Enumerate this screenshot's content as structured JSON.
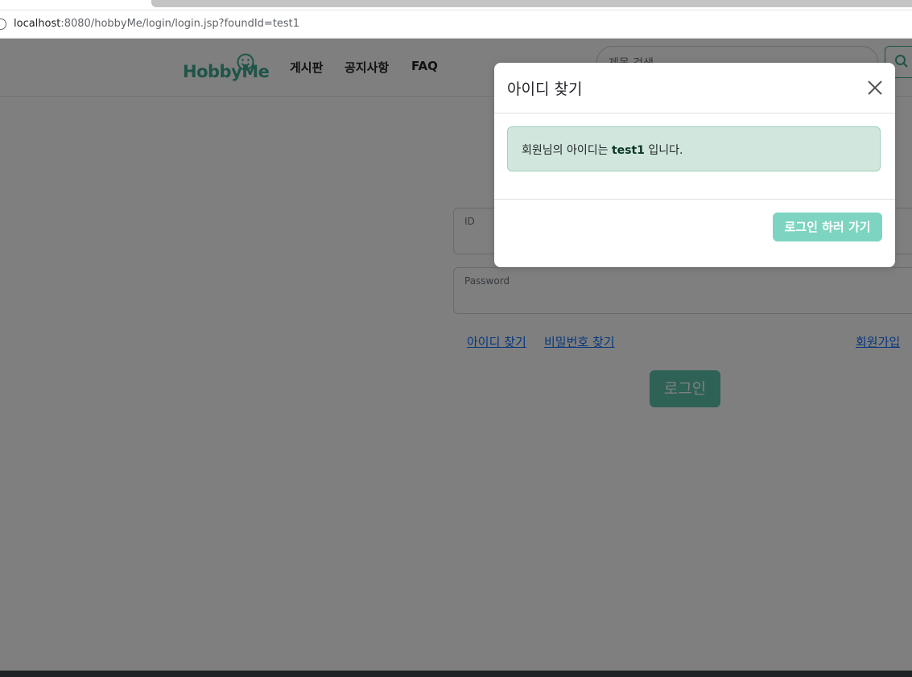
{
  "browser": {
    "url_host": "localhost",
    "url_rest": ":8080/hobbyMe/login/login.jsp?foundId=test1"
  },
  "navbar": {
    "logo_text": "HobbyMe",
    "items": [
      {
        "label": "게시판"
      },
      {
        "label": "공지사항"
      },
      {
        "label": "FAQ"
      }
    ],
    "search_placeholder": "제목 검색"
  },
  "login_form": {
    "id_label": "ID",
    "password_label": "Password",
    "find_id_link": "아이디 찾기",
    "find_password_link": "비밀번호 찾기",
    "signup_link": "회원가입",
    "login_button": "로그인"
  },
  "modal": {
    "title": "아이디 찾기",
    "message_prefix": "회원님의 아이디는 ",
    "found_id": "test1",
    "message_suffix": " 입니다.",
    "go_login_button": "로그인 하러 가기"
  },
  "colors": {
    "brand": "#3fa891",
    "alert_bg": "#d1e7dd",
    "button": "#7dd4c0"
  }
}
